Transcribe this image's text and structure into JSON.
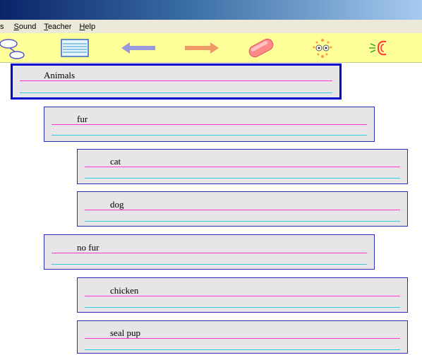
{
  "menu": {
    "items": [
      {
        "prefix": "",
        "underline": "s",
        "rest": ""
      },
      {
        "prefix": "",
        "underline": "S",
        "rest": "ound"
      },
      {
        "prefix": "",
        "underline": "T",
        "rest": "eacher"
      },
      {
        "prefix": "",
        "underline": "H",
        "rest": "elp"
      }
    ]
  },
  "toolbar": {
    "icons": [
      "diagram-icon",
      "lined-note-icon",
      "back-arrow-icon",
      "forward-arrow-icon",
      "eraser-icon",
      "look-eyes-icon",
      "listen-ear-icon"
    ]
  },
  "colors": {
    "card_bg": "#e8e5e8",
    "card_border": "#2c2cb0",
    "guide_pink": "#ff33cc",
    "guide_cyan": "#33ccdd",
    "toolbar_bg": "#ffff99"
  },
  "cards": [
    {
      "text": "Animals",
      "level": 0,
      "selected": true
    },
    {
      "text": "fur",
      "level": 1,
      "selected": false
    },
    {
      "text": "cat",
      "level": 2,
      "selected": false
    },
    {
      "text": "dog",
      "level": 2,
      "selected": false
    },
    {
      "text": "no fur",
      "level": 1,
      "selected": false
    },
    {
      "text": "chicken",
      "level": 2,
      "selected": false
    },
    {
      "text": "seal pup",
      "level": 2,
      "selected": false
    }
  ]
}
